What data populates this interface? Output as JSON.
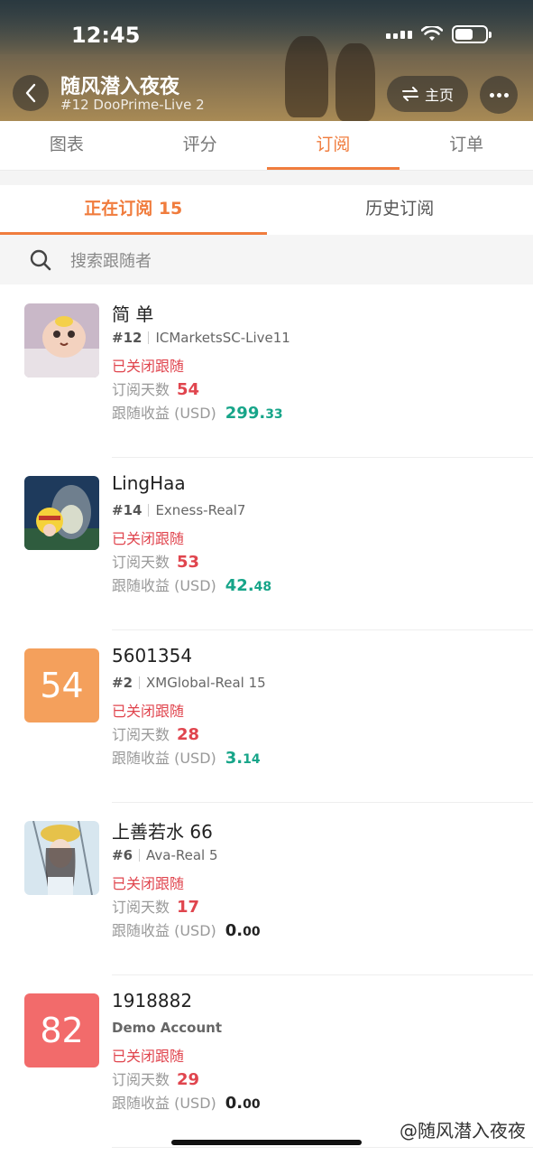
{
  "status_bar": {
    "time": "12:45"
  },
  "header": {
    "title": "随风潜入夜夜",
    "subtitle": "#12 DooPrime-Live 2",
    "home_label": "主页"
  },
  "main_tabs": [
    {
      "label": "图表"
    },
    {
      "label": "评分"
    },
    {
      "label": "订阅",
      "active": true
    },
    {
      "label": "订单"
    }
  ],
  "sub_tabs": [
    {
      "label": "正在订阅 15",
      "active": true
    },
    {
      "label": "历史订阅"
    }
  ],
  "search": {
    "placeholder": "搜索跟随者"
  },
  "labels": {
    "days": "订阅天数",
    "profit": "跟随收益 (USD)"
  },
  "followers": [
    {
      "name": "简 单",
      "rank": "#12",
      "broker": "ICMarketsSC-Live11",
      "status": "已关闭跟随",
      "days": "54",
      "profit_int": "299.",
      "profit_dec": "33",
      "profit_color": "#17a589",
      "avatar": "photo-baby"
    },
    {
      "name": "LingHaa",
      "rank": "#14",
      "broker": "Exness-Real7",
      "status": "已关闭跟随",
      "days": "53",
      "profit_int": "42.",
      "profit_dec": "48",
      "profit_color": "#17a589",
      "avatar": "photo-cartoon"
    },
    {
      "name": "5601354",
      "rank": "#2",
      "broker": "XMGlobal-Real 15",
      "status": "已关闭跟随",
      "days": "28",
      "profit_int": "3.",
      "profit_dec": "14",
      "profit_color": "#17a589",
      "avatar_text": "54",
      "avatar_color": "#f4a05c"
    },
    {
      "name": "上善若水 66",
      "rank": "#6",
      "broker": "Ava-Real 5",
      "status": "已关闭跟随",
      "days": "17",
      "profit_int": "0.",
      "profit_dec": "00",
      "profit_color": "#222222",
      "avatar": "photo-girl"
    },
    {
      "name": "1918882",
      "account_label": "Demo Account",
      "status": "已关闭跟随",
      "days": "29",
      "profit_int": "0.",
      "profit_dec": "00",
      "profit_color": "#222222",
      "avatar_text": "82",
      "avatar_color": "#f26b6b"
    }
  ],
  "watermark": "@随风潜入夜夜",
  "colors": {
    "accent": "#f07c3d",
    "danger": "#e0454e",
    "positive": "#17a589"
  }
}
